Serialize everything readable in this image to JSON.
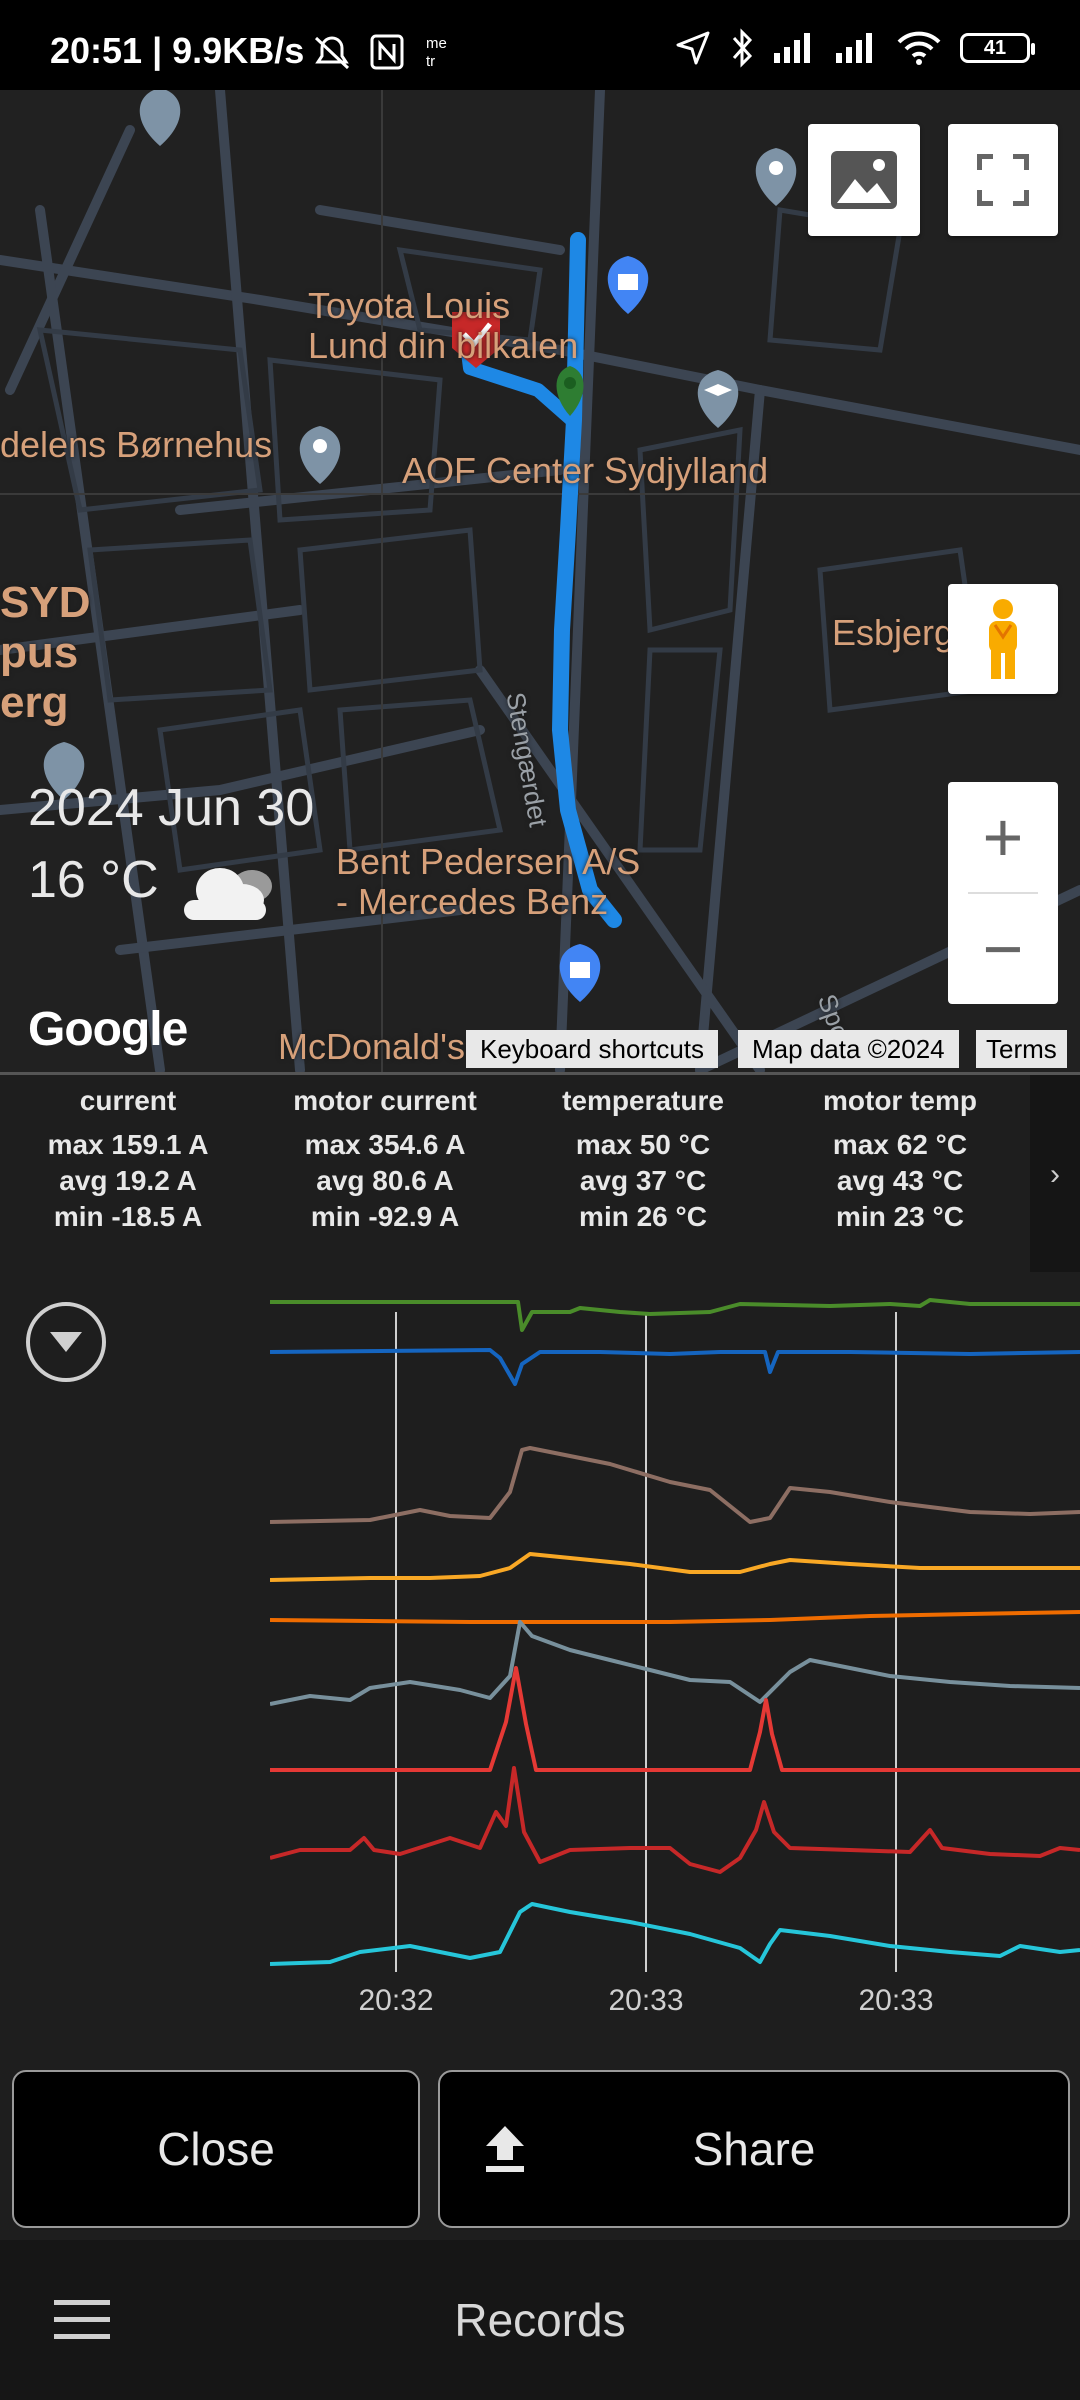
{
  "status_bar": {
    "text": "20:51 | 9.9KB/s",
    "battery": "41",
    "icons": [
      "bell-off-icon",
      "nfc-icon",
      "meter-app-icon",
      "location-arrow-icon",
      "bluetooth-icon",
      "signal-icon",
      "signal-icon",
      "wifi-icon",
      "battery-icon"
    ]
  },
  "map": {
    "labels": {
      "toyota": "Toyota Louis\nLund din bilkalen",
      "bornehus": "delens Børnehus",
      "aof": "AOF Center Sydjylland",
      "syd": "SYD\npus\nerg",
      "esbjerg": "Esbjerg",
      "street1": "Stengærdet",
      "bent": "Bent Pedersen A/S\n- Mercedes Benz",
      "mcdonalds": "McDonald's",
      "street2": "Spo"
    },
    "date": "2024 Jun 30",
    "temperature": "16 °C",
    "weather_icon": "cloud-icon",
    "google_logo": "Google",
    "attribution": {
      "shortcuts": "Keyboard shortcuts",
      "data": "Map data ©2024",
      "terms": "Terms"
    },
    "colors": {
      "route": "#1e88e5",
      "start_marker": "#2e7d32",
      "end_marker": "#c62828"
    }
  },
  "stats": [
    {
      "title": "current",
      "max": "max 159.1 A",
      "avg": "avg 19.2 A",
      "min": "min -18.5 A"
    },
    {
      "title": "motor current",
      "max": "max 354.6 A",
      "avg": "avg 80.6 A",
      "min": "min -92.9 A"
    },
    {
      "title": "temperature",
      "max": "max 50 °C",
      "avg": "avg 37 °C",
      "min": "min 26 °C"
    },
    {
      "title": "motor temp",
      "max": "max 62 °C",
      "avg": "avg 43 °C",
      "min": "min 23 °C"
    }
  ],
  "stats_more": "›",
  "chart": {
    "x_ticks": [
      "20:32",
      "20:33",
      "20:33"
    ],
    "series_colors": [
      "#4a8c2a",
      "#1565c0",
      "#8d6e63",
      "#f9a825",
      "#ef6c00",
      "#78909c",
      "#e53935",
      "#c62828",
      "#26c6da"
    ]
  },
  "buttons": {
    "close": "Close",
    "share": "Share"
  },
  "bottom_bar": {
    "title": "Records"
  }
}
